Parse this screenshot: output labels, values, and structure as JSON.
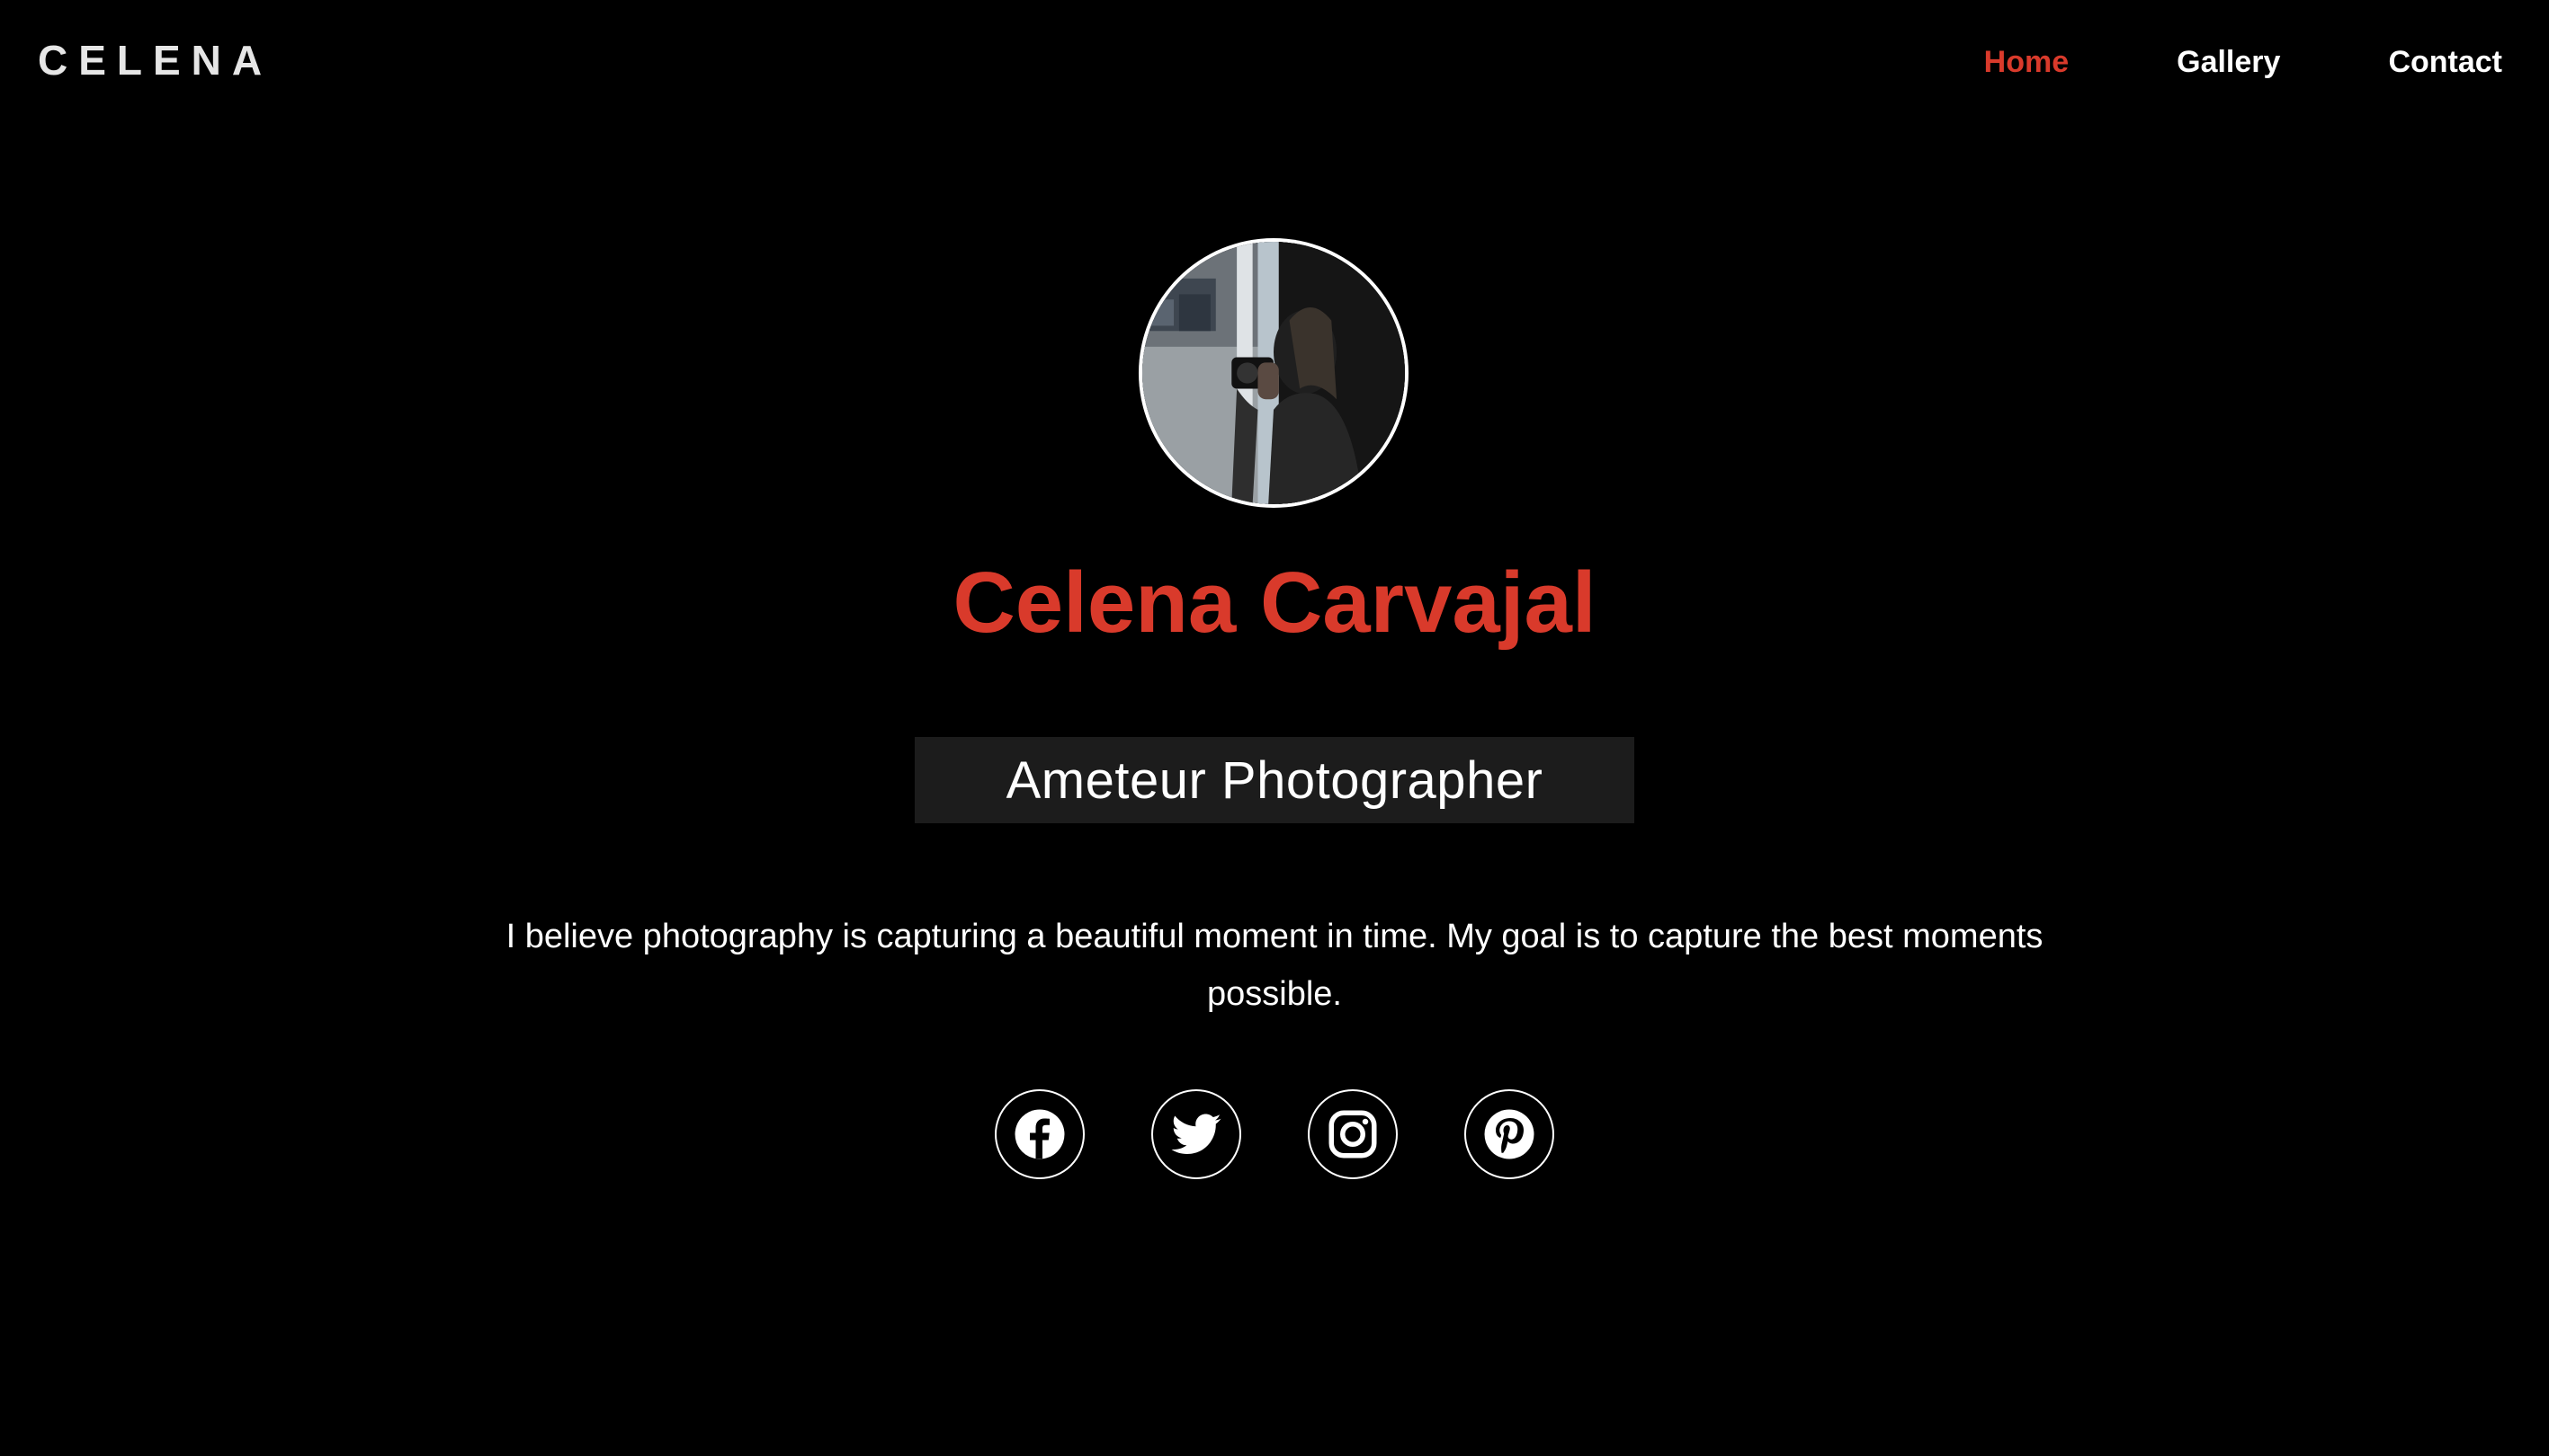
{
  "header": {
    "logo": "CELENA",
    "nav": [
      {
        "label": "Home",
        "active": true
      },
      {
        "label": "Gallery",
        "active": false
      },
      {
        "label": "Contact",
        "active": false
      }
    ]
  },
  "hero": {
    "avatar_alt": "photographer-with-camera",
    "name": "Celena Carvajal",
    "role": "Ameteur Photographer",
    "bio": "I believe photography is capturing a beautiful moment in time. My goal is to capture the best moments possible."
  },
  "socials": [
    {
      "icon": "facebook-icon"
    },
    {
      "icon": "twitter-icon"
    },
    {
      "icon": "instagram-icon"
    },
    {
      "icon": "pinterest-icon"
    }
  ],
  "colors": {
    "background": "#000000",
    "accent": "#d93a2b",
    "role_box": "#1c1c1c",
    "text": "#ffffff",
    "logo": "#e6e6e6"
  }
}
